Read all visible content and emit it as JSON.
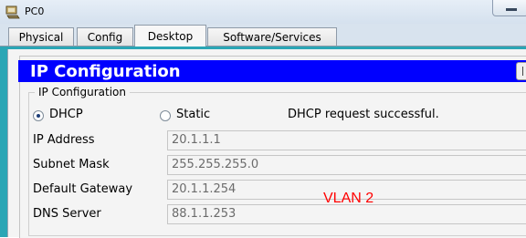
{
  "window": {
    "title": "PC0"
  },
  "tabs": [
    {
      "label": "Physical",
      "active": false
    },
    {
      "label": "Config",
      "active": false
    },
    {
      "label": "Desktop",
      "active": true
    },
    {
      "label": "Software/Services",
      "active": false
    }
  ],
  "ip_config": {
    "header_title": "IP Configuration",
    "group_label": "IP Configuration",
    "mode_options": [
      {
        "label": "DHCP",
        "selected": true
      },
      {
        "label": "Static",
        "selected": false
      }
    ],
    "status_message": "DHCP request successful.",
    "fields": [
      {
        "label": "IP Address",
        "value": "20.1.1.1"
      },
      {
        "label": "Subnet Mask",
        "value": "255.255.255.0"
      },
      {
        "label": "Default Gateway",
        "value": "20.1.1.254"
      },
      {
        "label": "DNS Server",
        "value": "88.1.1.253"
      }
    ]
  },
  "annotation": "VLAN 2",
  "colors": {
    "header_bar": "#0000ff",
    "content_background": "#2ba6b5",
    "annotation": "#ff0000"
  }
}
